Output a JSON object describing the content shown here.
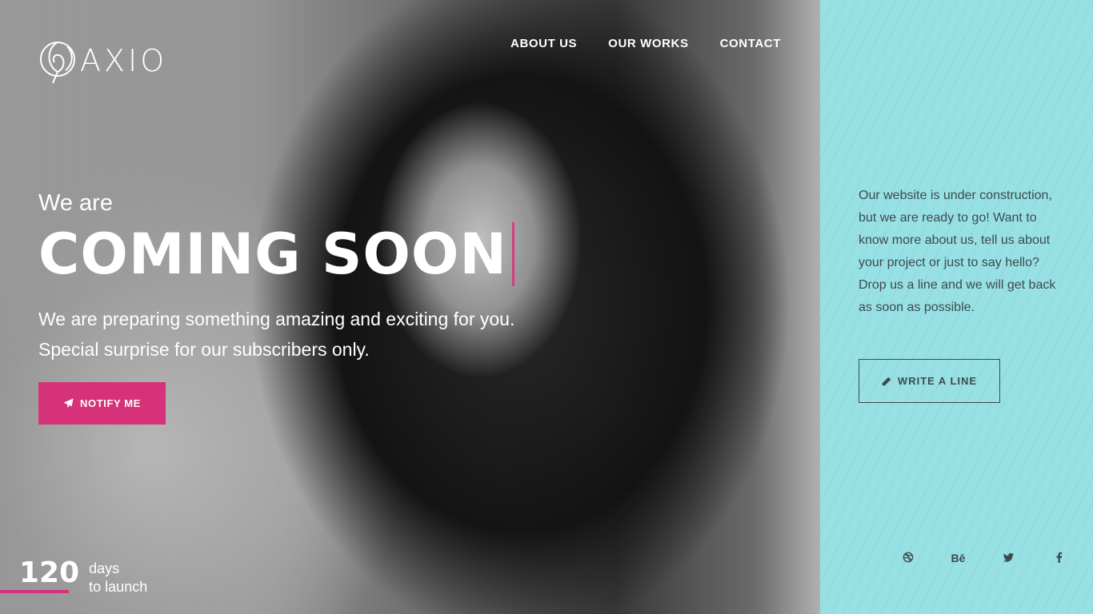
{
  "brand": {
    "name": "AXIO"
  },
  "nav": {
    "items": [
      {
        "label": "ABOUT US"
      },
      {
        "label": "OUR WORKS"
      },
      {
        "label": "CONTACT"
      }
    ]
  },
  "hero": {
    "intro": "We are",
    "headline": "COMING SOON",
    "subtitle": "We are preparing something amazing and exciting for you. Special surprise for our subscribers only.",
    "notify_label": "NOTIFY ME"
  },
  "countdown": {
    "value": "120",
    "label_line1": "days",
    "label_line2": "to launch"
  },
  "panel": {
    "text": "Our website is under construction, but we are ready to go! Want to know more about us, tell us about your project or just to say hello? Drop us a line and we will get back as soon as possible.",
    "write_label": "WRITE A LINE"
  },
  "social": {
    "behance_label": "Bē"
  },
  "colors": {
    "accent": "#d6327a",
    "panel_bg": "#97e1e5",
    "panel_text": "#3e4a4c"
  }
}
